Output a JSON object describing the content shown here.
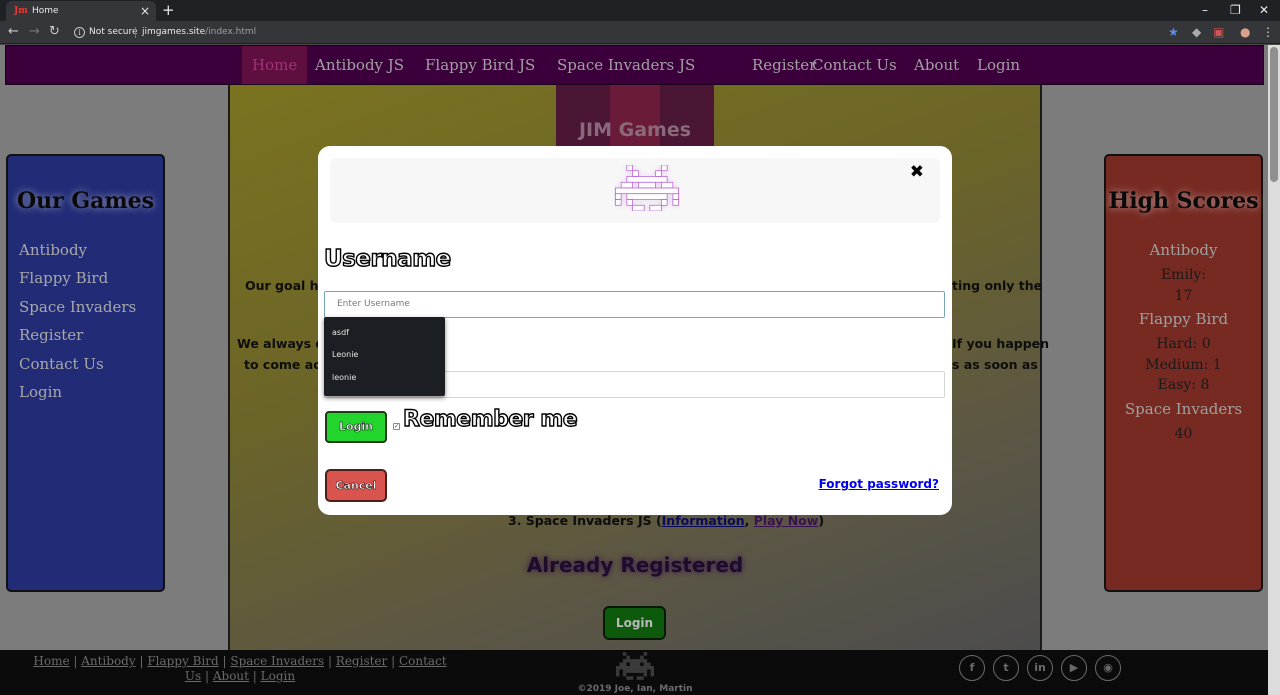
{
  "browser": {
    "tab_title": "Home",
    "security": "Not secure",
    "url_host": "jimgames.site",
    "url_path": "/index.html"
  },
  "nav": {
    "items": [
      {
        "label": "Home",
        "active": true
      },
      {
        "label": "Antibody JS"
      },
      {
        "label": "Flappy Bird JS"
      },
      {
        "label": "Space Invaders JS"
      },
      {
        "label": "Register"
      },
      {
        "label": "Contact Us"
      },
      {
        "label": "About"
      },
      {
        "label": "Login"
      }
    ]
  },
  "logo": {
    "text": "JIM Games"
  },
  "left_sidebar": {
    "heading": "Our Games",
    "links": [
      "Antibody",
      "Flappy Bird",
      "Space Invaders",
      "Register",
      "Contact Us",
      "Login"
    ]
  },
  "right_sidebar": {
    "heading": "High Scores",
    "antibody_title": "Antibody",
    "antibody_name": "Emily:",
    "antibody_score": "17",
    "flappy_title": "Flappy Bird",
    "flappy_hard": "Hard: 0",
    "flappy_medium": "Medium: 1",
    "flappy_easy": "Easy: 8",
    "invaders_title": "Space Invaders",
    "invaders_score": "40"
  },
  "main": {
    "goal_left": "Our goal her",
    "goal_right": "ting only the",
    "always_left": "We always do",
    "always_right": "If you happen",
    "come_left": "to come acro",
    "come_right": "s as soon as",
    "invaders_line_prefix": "3. Space Invaders JS (",
    "invaders_info": "Information",
    "invaders_comma": ", ",
    "invaders_play": "Play Now",
    "invaders_line_suffix": ")",
    "already_registered": "Already Registered",
    "login_button": "Login"
  },
  "modal": {
    "username_label": "Username",
    "username_placeholder": "Enter Username",
    "autocomplete": [
      "asdf",
      "Leonie",
      "leonie"
    ],
    "login_button": "Login",
    "remember_label": "Remember me",
    "cancel_button": "Cancel",
    "forgot_link": "Forgot password?"
  },
  "footer": {
    "links": [
      "Home",
      "Antibody",
      "Flappy Bird",
      "Space Invaders",
      "Register",
      "Contact Us",
      "About",
      "Login"
    ],
    "copyright": "©2019 Joe, Ian, Martin",
    "social": [
      "facebook-icon",
      "twitter-icon",
      "linkedin-icon",
      "youtube-icon",
      "github-icon"
    ]
  },
  "colors": {
    "nav_bg": "#3b003b",
    "left_sidebar": "#222c76",
    "right_sidebar": "#762a22",
    "login_green": "#23d42c",
    "cancel_red": "#d9534f"
  }
}
